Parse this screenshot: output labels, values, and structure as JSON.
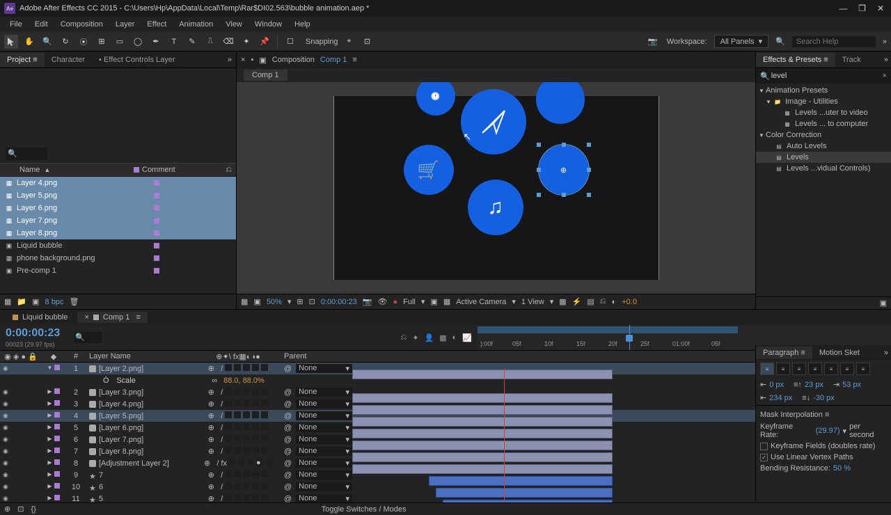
{
  "titlebar": {
    "app": "Ae",
    "title": "Adobe After Effects CC 2015 - C:\\Users\\Hp\\AppData\\Local\\Temp\\Rar$DI02.563\\bubble animation.aep *"
  },
  "menu": [
    "File",
    "Edit",
    "Composition",
    "Layer",
    "Effect",
    "Animation",
    "View",
    "Window",
    "Help"
  ],
  "toolbar": {
    "snapping": "Snapping",
    "workspace_label": "Workspace:",
    "workspace_value": "All Panels",
    "search_placeholder": "Search Help",
    "search_icon": "🔍"
  },
  "project": {
    "tabs": {
      "project": "Project",
      "character": "Character",
      "effect_controls": "Effect Controls Layer"
    },
    "search_placeholder": "🔍",
    "headers": {
      "name": "Name",
      "comment": "Comment",
      "sort": "▲"
    },
    "rows": [
      {
        "name": "Layer 4.png",
        "selected": true,
        "type": "img"
      },
      {
        "name": "Layer 5.png",
        "selected": true,
        "type": "img"
      },
      {
        "name": "Layer 6.png",
        "selected": true,
        "type": "img"
      },
      {
        "name": "Layer 7.png",
        "selected": true,
        "type": "img"
      },
      {
        "name": "Layer 8.png",
        "selected": true,
        "type": "img"
      },
      {
        "name": "Liquid bubble",
        "selected": false,
        "type": "comp"
      },
      {
        "name": "phone background.png",
        "selected": false,
        "type": "img"
      },
      {
        "name": "Pre-comp 1",
        "selected": false,
        "type": "comp"
      }
    ],
    "footer": {
      "bpc": "8 bpc"
    }
  },
  "comp": {
    "label": "Composition",
    "name": "Comp 1",
    "tab": "Comp 1",
    "zoom": "50%",
    "tc": "0:00:00:23",
    "res": "Full",
    "camera": "Active Camera",
    "view": "1 View",
    "offset": "+0.0"
  },
  "effects": {
    "tabs": {
      "presets": "Effects & Presets",
      "track": "Track"
    },
    "search": "level",
    "tree": {
      "presets": "Animation Presets",
      "image": "Image - Utilities",
      "lev_video": "Levels ...uter to video",
      "lev_computer": "Levels ... to computer",
      "color": "Color Correction",
      "auto": "Auto Levels",
      "levels": "Levels",
      "levels_ctrl": "Levels ...vidual Controls)"
    }
  },
  "timeline": {
    "tabs": {
      "liquid": "Liquid bubble",
      "comp1": "Comp 1"
    },
    "tc": "0:00:00:23",
    "sub": "00023 (29.97 fps)",
    "ruler": [
      "):00f",
      "05f",
      "10f",
      "15f",
      "20f",
      "25f",
      "01:00f",
      "05f"
    ],
    "columns": {
      "num": "#",
      "layername": "Layer Name",
      "parent": "Parent"
    },
    "layers": [
      {
        "num": 1,
        "name": "[Layer 2.png]",
        "parent": "None",
        "selected": true,
        "twirl": "▼"
      },
      {
        "num": "",
        "name": "Scale",
        "prop": true,
        "val": "88.0, 88.0%"
      },
      {
        "num": 2,
        "name": "[Layer 3.png]",
        "parent": "None"
      },
      {
        "num": 3,
        "name": "[Layer 4.png]",
        "parent": "None"
      },
      {
        "num": 4,
        "name": "[Layer 5.png]",
        "parent": "None",
        "selected": true
      },
      {
        "num": 5,
        "name": "[Layer 6.png]",
        "parent": "None"
      },
      {
        "num": 6,
        "name": "[Layer 7.png]",
        "parent": "None"
      },
      {
        "num": 7,
        "name": "[Layer 8.png]",
        "parent": "None"
      },
      {
        "num": 8,
        "name": "[Adjustment Layer 2]",
        "parent": "None",
        "adj": true
      },
      {
        "num": 9,
        "name": "7",
        "parent": "None",
        "shape": true
      },
      {
        "num": 10,
        "name": "6",
        "parent": "None",
        "shape": true
      },
      {
        "num": 11,
        "name": "5",
        "parent": "None",
        "shape": true
      }
    ],
    "footer": "Toggle Switches / Modes"
  },
  "paragraph": {
    "tab_para": "Paragraph",
    "tab_motion": "Motion Sket",
    "indent": {
      "v1": "0 px",
      "v2": "23 px",
      "v3": "53 px",
      "v4": "234 px",
      "v5": "-30 px"
    }
  },
  "mask": {
    "title": "Mask Interpolation",
    "rate_label": "Keyframe Rate:",
    "rate_val": "(29.97)",
    "rate_unit": "per second",
    "fields": "Keyframe Fields (doubles rate)",
    "linear": "Use Linear Vertex Paths",
    "bend_label": "Bending Resistance:",
    "bend_val": "50 %"
  }
}
